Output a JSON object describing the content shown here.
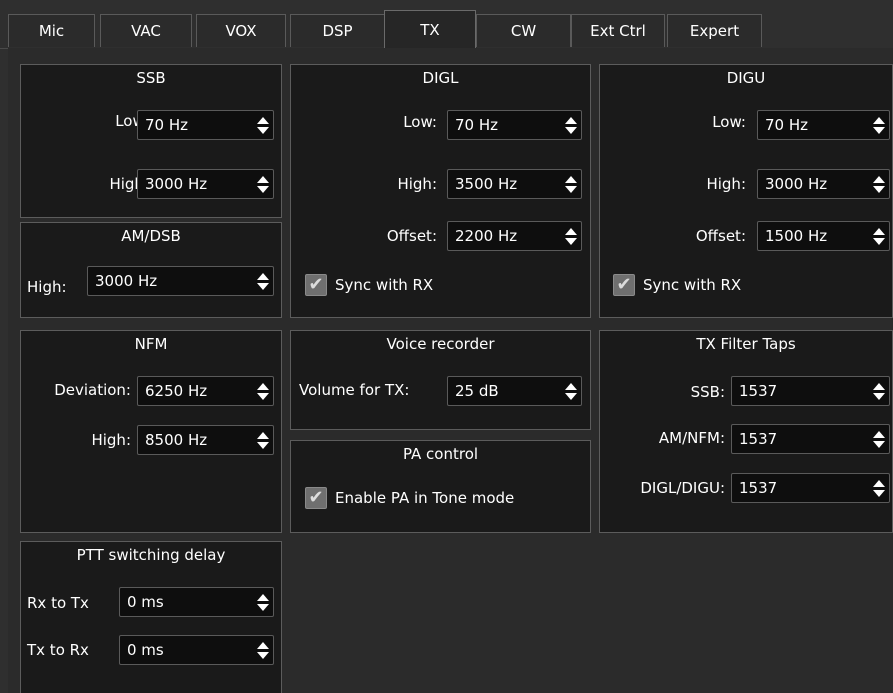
{
  "tabs": [
    "Mic",
    "VAC",
    "VOX",
    "DSP",
    "TX",
    "CW",
    "Ext Ctrl",
    "Expert"
  ],
  "active_tab": "TX",
  "ssb": {
    "title": "SSB",
    "low_label": "Low:",
    "low_value": "70 Hz",
    "high_label": "High:",
    "high_value": "3000 Hz"
  },
  "amdsb": {
    "title": "AM/DSB",
    "high_label": "High:",
    "high_value": "3000 Hz"
  },
  "digl": {
    "title": "DIGL",
    "low_label": "Low:",
    "low_value": "70 Hz",
    "high_label": "High:",
    "high_value": "3500 Hz",
    "offset_label": "Offset:",
    "offset_value": "2200 Hz",
    "sync_label": "Sync with RX",
    "sync_checked": true
  },
  "digu": {
    "title": "DIGU",
    "low_label": "Low:",
    "low_value": "70 Hz",
    "high_label": "High:",
    "high_value": "3000 Hz",
    "offset_label": "Offset:",
    "offset_value": "1500 Hz",
    "sync_label": "Sync with RX",
    "sync_checked": true
  },
  "nfm": {
    "title": "NFM",
    "deviation_label": "Deviation:",
    "deviation_value": "6250 Hz",
    "high_label": "High:",
    "high_value": "8500 Hz"
  },
  "voice_recorder": {
    "title": "Voice recorder",
    "volume_label": "Volume for TX:",
    "volume_value": "25 dB"
  },
  "pa_control": {
    "title": "PA control",
    "enable_label": "Enable PA in Tone mode",
    "enable_checked": true
  },
  "tx_filter_taps": {
    "title": "TX Filter Taps",
    "ssb_label": "SSB:",
    "ssb_value": "1537",
    "amnfm_label": "AM/NFM:",
    "amnfm_value": "1537",
    "digl_digu_label": "DIGL/DIGU:",
    "digl_digu_value": "1537"
  },
  "ptt": {
    "title": "PTT switching delay",
    "rx_to_tx_label": "Rx to Tx",
    "rx_to_tx_value": "0 ms",
    "tx_to_rx_label": "Tx to Rx",
    "tx_to_rx_value": "0 ms"
  },
  "colors": {
    "background": "#2f2f2f",
    "groupbox": "#1a1a1a",
    "field": "#0e0e0e",
    "border": "#5c5c5c",
    "text": "#ffffff"
  },
  "icons": [
    "spin-up-arrow-icon",
    "spin-down-arrow-icon",
    "checkmark-icon"
  ]
}
